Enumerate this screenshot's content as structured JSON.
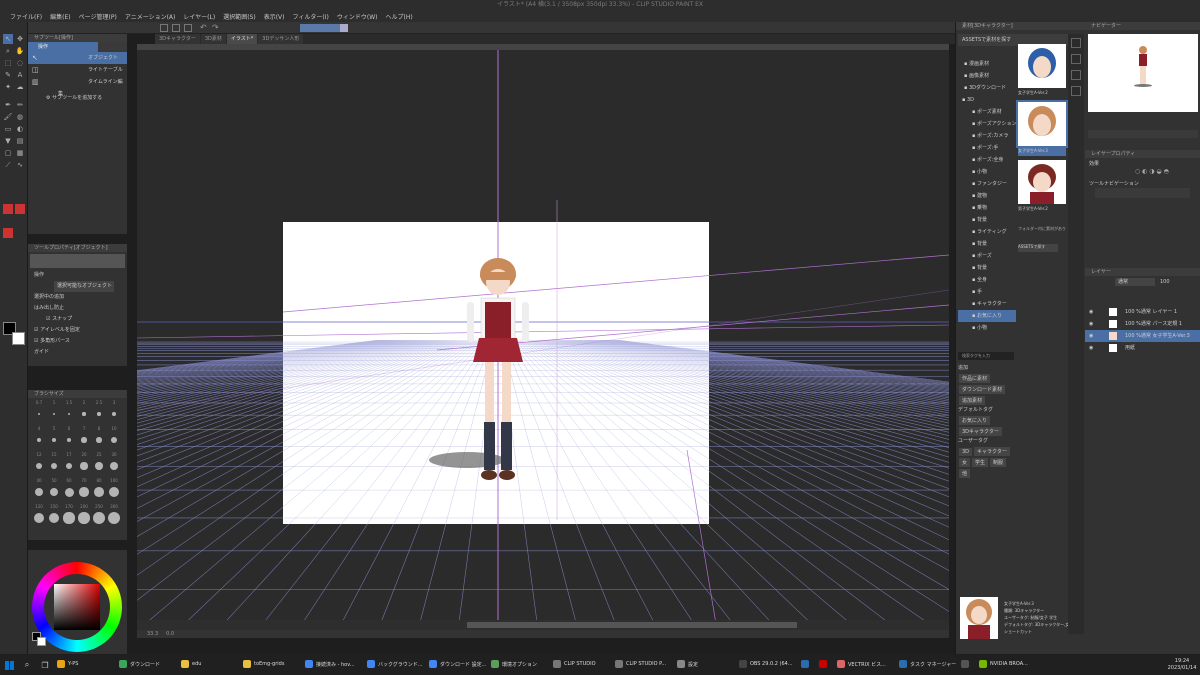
{
  "window": {
    "title": "イラスト* (A4 横(3.1 / 3508px 350dpi 33.3%) - CLIP STUDIO PAINT EX"
  },
  "menu": [
    "ファイル(F)",
    "編集(E)",
    "ページ管理(P)",
    "アニメーション(A)",
    "レイヤー(L)",
    "選択範囲(S)",
    "表示(V)",
    "フィルター(I)",
    "ウィンドウ(W)",
    "ヘルプ(H)"
  ],
  "tabs": [
    "3Dキャラクター",
    "3D素材",
    "イラスト*",
    "3Dデッサン人形"
  ],
  "subtool": {
    "header": "サブツール[操作]",
    "tab": "操作",
    "items": [
      "オブジェクト",
      "ライトテーブル",
      "タイムライン編集"
    ],
    "add": "サブツールを追加する"
  },
  "toolprop": {
    "header": "ツールプロパティ[オブジェクト]",
    "rows": [
      "操作",
      "選択可能なオブジェクト",
      "選択中の追加",
      "はみ出し防止",
      "スナップ",
      "アイレベルを固定",
      "多角形パース",
      "ガイド"
    ]
  },
  "brush": {
    "header": "ブラシサイズ",
    "labels": [
      "0.7",
      "1",
      "1.5",
      "2",
      "2.5",
      "3",
      "4",
      "5",
      "6",
      "7",
      "8",
      "10",
      "12",
      "15",
      "17",
      "20",
      "25",
      "30",
      "40",
      "50",
      "60",
      "70",
      "80",
      "100",
      "120",
      "150",
      "170",
      "200",
      "250",
      "300"
    ]
  },
  "status": {
    "zoom": "33.3",
    "angle": "0.0"
  },
  "material": {
    "header": "素材[3Dキャラクター]",
    "search": "ASSETSで素材を探す",
    "tree": [
      "漫画素材",
      "画像素材",
      "3Dダウンロード",
      "3D",
      "ポーズ素材",
      "ポーズアクション",
      "ポーズ:カメラ",
      "ポーズ:手",
      "ポーズ:全身",
      "小物",
      "ファンタジー",
      "建物",
      "乗物",
      "背景",
      "ライティング",
      "背景",
      "ポーズ",
      "背景",
      "全身",
      "手",
      "キャラクター",
      "お気に入り",
      "小物"
    ],
    "thumbs": [
      "女子学生A-Ver.2",
      "女子学生A-Ver.3",
      "男子学生A-Ver.2"
    ],
    "assets_label": "フォルダー内に素材がありません",
    "assets_btn": "ASSETSで探す",
    "tagsearch": "検索タグを入力",
    "tagsection": [
      "追加",
      "作品に素材",
      "ダウンロード素材",
      "追加素材",
      "デフォルトタグ",
      "お気に入り",
      "3Dキャラクター",
      "ユーザータグ",
      "3D",
      "キャラクター",
      "女",
      "学生",
      "制服",
      "他"
    ],
    "info_name": "女子学生A-Ver.3",
    "info_detail": [
      "種類: 3Dキャラクター",
      "ユーザータグ: 制服/女子 学生",
      "デフォルトタグ: 3Dキャラクター,女",
      "ショートカット"
    ]
  },
  "navigator": {
    "header": "ナビゲーター",
    "subheader": "レイヤープロパティ",
    "effect": "効果",
    "nav": "ツールナビゲーション"
  },
  "layers": {
    "header": "レイヤー",
    "blend": "通常",
    "opacity": "100",
    "rows": [
      {
        "name": "100 %通常",
        "sub": "レイヤー 1"
      },
      {
        "name": "100 %通常",
        "sub": "パース定規 1"
      },
      {
        "name": "100 %通常",
        "sub": "女子学生A-Ver.3"
      },
      {
        "name": "用紙",
        "sub": ""
      }
    ]
  },
  "taskbar": {
    "items": [
      "Y-PS",
      "ダウンロード",
      "edu",
      "toEmg-grids",
      "接続済み - hov...",
      "バックグラウンド...",
      "ダウンロード 設定...",
      "環境オプション",
      "CLIP STUDIO",
      "CLIP STUDIO P...",
      "設定",
      "OBS 29.0.2 (64...",
      "",
      "",
      "VECTRIX ビス...",
      "タスク マネージャー",
      "",
      "NVIDIA BROA..."
    ],
    "time": "19:24",
    "date": "2023/01/14"
  },
  "colors": {
    "main": "#000000",
    "sub": "#ffffff",
    "selection": "#4a6fa5"
  }
}
